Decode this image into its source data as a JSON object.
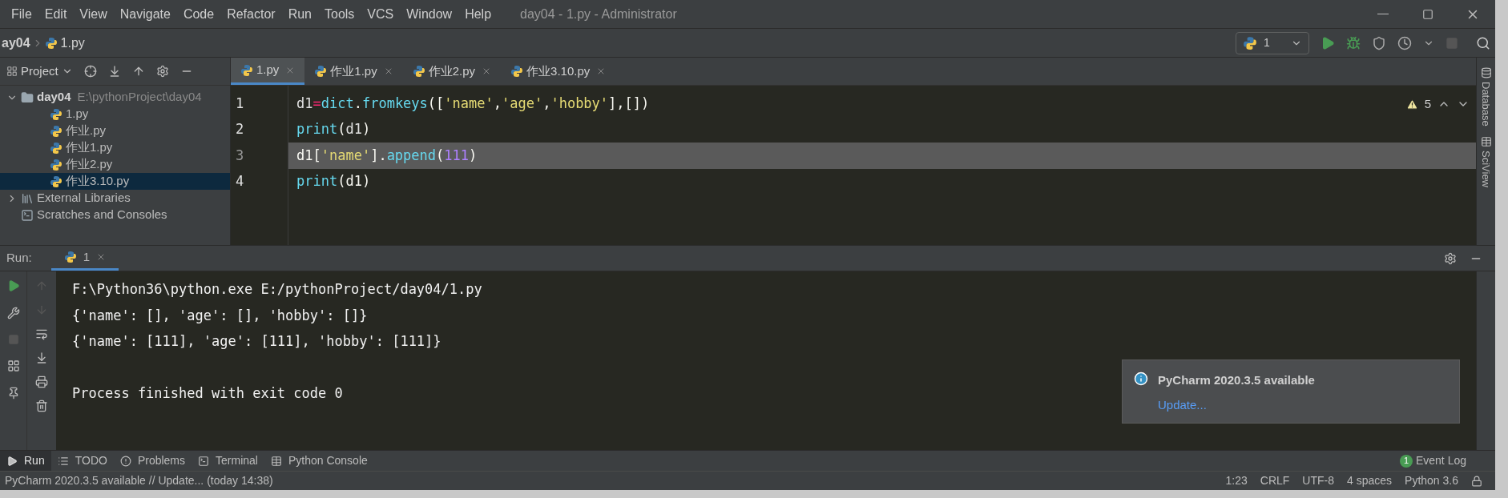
{
  "menu": [
    "File",
    "Edit",
    "View",
    "Navigate",
    "Code",
    "Refactor",
    "Run",
    "Tools",
    "VCS",
    "Window",
    "Help"
  ],
  "window": {
    "title": "day04 - 1.py - Administrator"
  },
  "breadcrumb": [
    "ay04",
    "1.py"
  ],
  "run_config": {
    "label": "1"
  },
  "project": {
    "label": "Project",
    "tree": [
      {
        "label": "day04",
        "path": "E:\\pythonProject\\day04",
        "kind": "folder",
        "expanded": true,
        "selected": false,
        "children": [
          {
            "label": "1.py",
            "kind": "file",
            "selected": false
          },
          {
            "label": "作业.py",
            "kind": "file",
            "selected": false
          },
          {
            "label": "作业1.py",
            "kind": "file",
            "selected": false
          },
          {
            "label": "作业2.py",
            "kind": "file",
            "selected": false
          },
          {
            "label": "作业3.10.py",
            "kind": "file",
            "selected": true
          }
        ]
      },
      {
        "label": "External Libraries",
        "kind": "libraries",
        "expanded": false,
        "selected": false
      },
      {
        "label": "Scratches and Consoles",
        "kind": "scratches",
        "selected": false
      }
    ]
  },
  "editor_tabs": [
    {
      "label": "1.py",
      "selected": true
    },
    {
      "label": "作业1.py",
      "selected": false
    },
    {
      "label": "作业2.py",
      "selected": false
    },
    {
      "label": "作业3.10.py",
      "selected": false
    }
  ],
  "warnings": "5",
  "code": [
    {
      "number": "1",
      "tokens": [
        {
          "kind": "var",
          "text": "d1"
        },
        {
          "kind": "op",
          "text": "="
        },
        {
          "kind": "fn",
          "text": "dict"
        },
        {
          "kind": "plain",
          "text": "."
        },
        {
          "kind": "fn",
          "text": "fromkeys"
        },
        {
          "kind": "plain",
          "text": "(["
        },
        {
          "kind": "str",
          "text": "'name'"
        },
        {
          "kind": "plain",
          "text": ","
        },
        {
          "kind": "str",
          "text": "'age'"
        },
        {
          "kind": "plain",
          "text": ","
        },
        {
          "kind": "str",
          "text": "'hobby'"
        },
        {
          "kind": "plain",
          "text": "],[])"
        }
      ]
    },
    {
      "number": "2",
      "tokens": [
        {
          "kind": "fn",
          "text": "print"
        },
        {
          "kind": "plain",
          "text": "("
        },
        {
          "kind": "var",
          "text": "d1"
        },
        {
          "kind": "plain",
          "text": ")"
        }
      ]
    },
    {
      "number": "3",
      "tokens": [
        {
          "kind": "plain",
          "text": "d1["
        },
        {
          "kind": "str",
          "text": "'name'"
        },
        {
          "kind": "plain",
          "text": "]."
        },
        {
          "kind": "fn",
          "text": "append"
        },
        {
          "kind": "plain",
          "text": "("
        },
        {
          "kind": "num",
          "text": "111"
        },
        {
          "kind": "plain",
          "text": ")"
        }
      ]
    },
    {
      "number": "4",
      "tokens": [
        {
          "kind": "fn",
          "text": "print"
        },
        {
          "kind": "plain",
          "text": "(d1)"
        }
      ]
    }
  ],
  "right_stripe": [
    "Database",
    "SciView"
  ],
  "run": {
    "label": "Run:",
    "tab": "1",
    "output": [
      "F:\\Python36\\python.exe E:/pythonProject/day04/1.py",
      "{'name': [], 'age': [], 'hobby': []}",
      "{'name': [111], 'age': [111], 'hobby': [111]}"
    ],
    "exit_message": "Process finished with exit code 0"
  },
  "notification": {
    "title": "PyCharm 2020.3.5 available",
    "link": "Update..."
  },
  "tool_tabs": [
    {
      "label": "Run",
      "kind": "run",
      "selected": true
    },
    {
      "label": "TODO",
      "kind": "todo",
      "selected": false
    },
    {
      "label": "Problems",
      "kind": "problems",
      "selected": false
    },
    {
      "label": "Terminal",
      "kind": "terminal",
      "selected": false
    },
    {
      "label": "Python Console",
      "kind": "console",
      "selected": false
    }
  ],
  "event_log": {
    "count": "1",
    "label": "Event Log"
  },
  "status_bar": {
    "message": "PyCharm 2020.3.5 available // Update... (today 14:38)",
    "items": [
      "1:23",
      "CRLF",
      "UTF-8",
      "4 spaces",
      "Python 3.6"
    ]
  }
}
